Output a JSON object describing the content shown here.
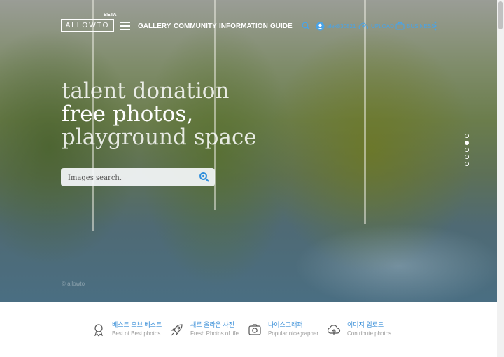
{
  "header": {
    "logo_text": "ALLOWTO",
    "beta_badge": "BETA",
    "nav": {
      "gallery": "GALLERY",
      "community": "COMMUNITY",
      "information": "INFORMATION",
      "guide": "GUIDE"
    },
    "username": "alex830821",
    "upload_label": "UPLOAD",
    "business_label": "BUSINESS",
    "accent_color": "#4aa3e6"
  },
  "hero": {
    "headline_line1": "talent donation",
    "headline_line2": "free photos,",
    "headline_line3": "playground space",
    "search_placeholder": "Images search.",
    "slide_count": 5,
    "active_slide": 2,
    "photo_credit": "© allowto"
  },
  "features": [
    {
      "icon": "medal-icon",
      "title": "베스트 오브 베스트",
      "subtitle": "Best of Best photos"
    },
    {
      "icon": "rocket-icon",
      "title": "새로 올라온 사진",
      "subtitle": "Fresh Photos of life"
    },
    {
      "icon": "camera-icon",
      "title": "나이스그래퍼",
      "subtitle": "Popular nicegrapher"
    },
    {
      "icon": "cloud-upload-icon",
      "title": "이미지 업로드",
      "subtitle": "Contribute photos"
    }
  ],
  "colors": {
    "feature_title": "#3a8fd8",
    "feature_subtitle": "#9b9b9b"
  }
}
